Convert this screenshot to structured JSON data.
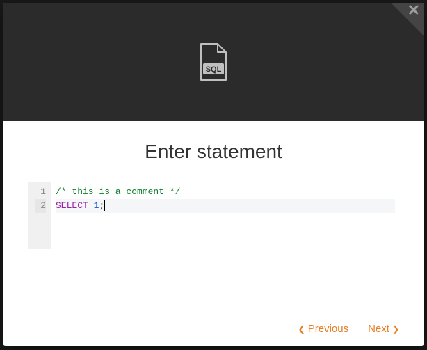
{
  "header": {
    "icon_label": "SQL",
    "close_glyph": "✕"
  },
  "title": "Enter statement",
  "editor": {
    "lines": [
      {
        "num": "1",
        "active": false,
        "tokens": [
          {
            "cls": "tok-comment",
            "text": "/* this is a comment */"
          }
        ]
      },
      {
        "num": "2",
        "active": true,
        "tokens": [
          {
            "cls": "tok-keyword",
            "text": "SELECT"
          },
          {
            "cls": "tok-plain",
            "text": " "
          },
          {
            "cls": "tok-number",
            "text": "1"
          },
          {
            "cls": "tok-plain",
            "text": ";"
          }
        ]
      }
    ]
  },
  "footer": {
    "prev_label": "Previous",
    "next_label": "Next"
  }
}
